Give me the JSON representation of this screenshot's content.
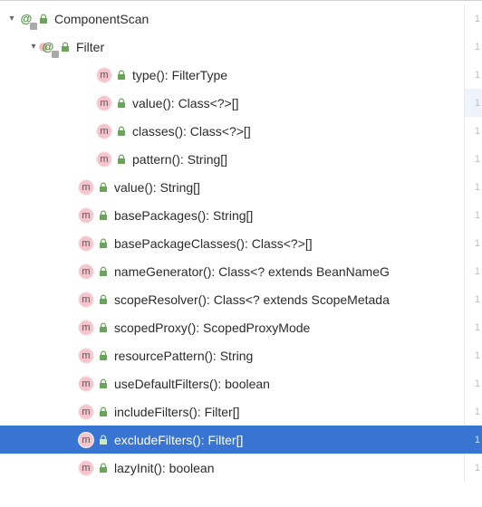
{
  "tree": {
    "root": {
      "label": "ComponentScan",
      "childLabel": "Filter",
      "filterMethods": [
        "type(): FilterType",
        "value(): Class<?>[]",
        "classes(): Class<?>[]",
        "pattern(): String[]"
      ],
      "methods": [
        "value(): String[]",
        "basePackages(): String[]",
        "basePackageClasses(): Class<?>[]",
        "nameGenerator(): Class<? extends BeanNameG",
        "scopeResolver(): Class<? extends ScopeMetada",
        "scopedProxy(): ScopedProxyMode",
        "resourcePattern(): String",
        "useDefaultFilters(): boolean",
        "includeFilters(): Filter[]",
        "excludeFilters(): Filter[]",
        "lazyInit(): boolean"
      ],
      "selectedMethodIndex": 9,
      "highlightedFilterMethodIndex": 1
    }
  },
  "glyphs": {
    "at": "@",
    "m": "m",
    "expanded": "▾",
    "gutter": "1"
  }
}
